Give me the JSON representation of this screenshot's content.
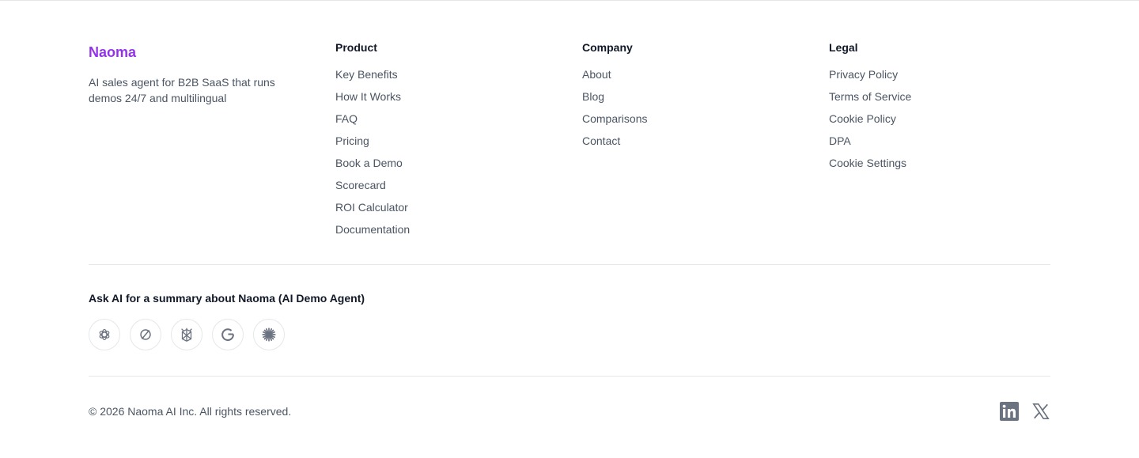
{
  "brand": {
    "name": "Naoma",
    "description": "AI sales agent for B2B SaaS that runs demos 24/7 and multilingual",
    "color": "#9333ea"
  },
  "columns": {
    "product": {
      "title": "Product",
      "links": [
        "Key Benefits",
        "How It Works",
        "FAQ",
        "Pricing",
        "Book a Demo",
        "Scorecard",
        "ROI Calculator",
        "Documentation"
      ]
    },
    "company": {
      "title": "Company",
      "links": [
        "About",
        "Blog",
        "Comparisons",
        "Contact"
      ]
    },
    "legal": {
      "title": "Legal",
      "links": [
        "Privacy Policy",
        "Terms of Service",
        "Cookie Policy",
        "DPA",
        "Cookie Settings"
      ]
    }
  },
  "ask_ai": {
    "title": "Ask AI for a summary about Naoma (AI Demo Agent)",
    "providers": [
      "chatgpt-icon",
      "perplexity-icon",
      "grok-icon",
      "google-icon",
      "claude-icon"
    ]
  },
  "copyright": "© 2026 Naoma AI Inc. All rights reserved.",
  "social": [
    "linkedin-icon",
    "x-icon"
  ],
  "colors": {
    "text_primary": "#111827",
    "text_secondary": "#4b5563",
    "icon": "#6b7280",
    "divider": "#e5e7eb"
  }
}
